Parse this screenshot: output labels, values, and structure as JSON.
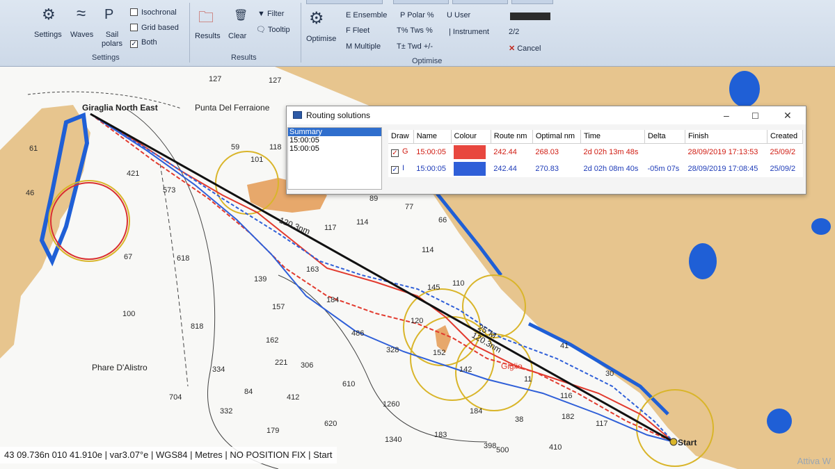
{
  "ribbon": {
    "settings_label": "Settings",
    "waves_label": "Waves",
    "sail_polars_label": "Sail polars",
    "isochronal_label": "Isochronal",
    "grid_based_label": "Grid based",
    "both_label": "Both",
    "settings_group": "Settings",
    "results_label": "Results",
    "clear_label": "Clear",
    "filter_label": "Filter",
    "tooltip_label": "Tooltip",
    "results_group": "Results",
    "optimise_label": "Optimise",
    "ensemble_label": "E Ensemble",
    "fleet_label": "F Fleet",
    "multiple_label": "M Multiple",
    "polar_pct_label": "P Polar %",
    "tws_pct_label": "T% Tws %",
    "twd_label": "T± Twd +/-",
    "user_label": "U User",
    "instrument_label": "| Instrument",
    "fraction_label": "2/2",
    "cancel_label": "Cancel",
    "optimise_group": "Optimise"
  },
  "dialog": {
    "title": "Routing solutions",
    "list": [
      "Summary",
      "15:00:05",
      "15:00:05"
    ],
    "columns": [
      "Draw",
      "Name",
      "Colour",
      "Route nm",
      "Optimal nm",
      "Time",
      "Delta",
      "Finish",
      "Created"
    ],
    "rows": [
      {
        "check": "✓",
        "letter": "G",
        "name": "15:00:05",
        "colour": "#e8473f",
        "route": "242.44",
        "optimal": "268.03",
        "time": "2d 02h 13m 48s",
        "delta": "",
        "finish": "28/09/2019 17:13:53",
        "created": "25/09/2"
      },
      {
        "check": "✓",
        "letter": "I",
        "name": "15:00:05",
        "colour": "#2f5fd8",
        "route": "242.44",
        "optimal": "270.83",
        "time": "2d 02h 08m 40s",
        "delta": "-05m 07s",
        "finish": "28/09/2019 17:08:45",
        "created": "25/09/2"
      }
    ]
  },
  "map": {
    "labels": {
      "punta_del_ferraione": "Punta Del Ferraione",
      "phare_dalistro": "Phare D'Alistro",
      "start": "Start",
      "giglio": "Giglio",
      "giraglia": "Giraglia North East",
      "route_label_1": "120.3nm",
      "route_label_2": "25°M",
      "route_label_3": "120.3nm"
    },
    "depths": [
      "127",
      "127",
      "59",
      "118",
      "101",
      "573",
      "421",
      "61",
      "46",
      "67",
      "618",
      "139",
      "100",
      "818",
      "157",
      "162",
      "221",
      "306",
      "334",
      "704",
      "84",
      "412",
      "332",
      "610",
      "620",
      "1260",
      "1340",
      "89",
      "77",
      "114",
      "66",
      "114",
      "117",
      "163",
      "184",
      "328",
      "486",
      "110",
      "145",
      "152",
      "142",
      "184",
      "41",
      "116",
      "182",
      "117",
      "30",
      "398",
      "500",
      "410",
      "38",
      "11",
      "179",
      "183",
      "120"
    ]
  },
  "status": {
    "text": "43 09.736n 010 41.910e | var3.07°e | WGS84 | Metres | NO POSITION FIX | Start"
  },
  "watermark": "Attiva W"
}
